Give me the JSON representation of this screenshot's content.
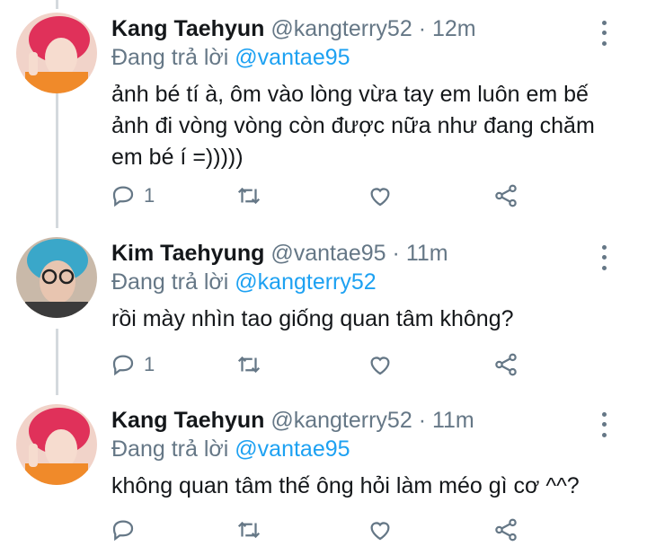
{
  "reply_prefix": "Đang trả lời",
  "colors": {
    "accent": "#1da1f2",
    "secondary": "#657786",
    "text": "#14171a",
    "thread_line": "#d4d9dd"
  },
  "tweets": [
    {
      "name": "Kang Taehyun",
      "handle": "@kangterry52",
      "separator": "·",
      "time": "12m",
      "reply_to": "@vantae95",
      "text": "ảnh bé tí à, ôm vào lòng vừa tay em luôn em bế ảnh đi vòng vòng còn được nữa như đang chăm em bé í =)))))",
      "reply_count": "1",
      "avatar_hair": "#e0315a"
    },
    {
      "name": "Kim Taehyung",
      "handle": "@vantae95",
      "separator": "·",
      "time": "11m",
      "reply_to": "@kangterry52",
      "text": "rồi mày nhìn tao giống quan tâm không?",
      "reply_count": "1",
      "avatar_hair": "#3aa7c9"
    },
    {
      "name": "Kang Taehyun",
      "handle": "@kangterry52",
      "separator": "·",
      "time": "11m",
      "reply_to": "@vantae95",
      "text": "không quan tâm thế ông hỏi làm méo gì cơ ^^?",
      "reply_count": "",
      "avatar_hair": "#e0315a"
    }
  ],
  "icons": [
    "reply-icon",
    "retweet-icon",
    "like-icon",
    "share-icon",
    "more-icon"
  ]
}
